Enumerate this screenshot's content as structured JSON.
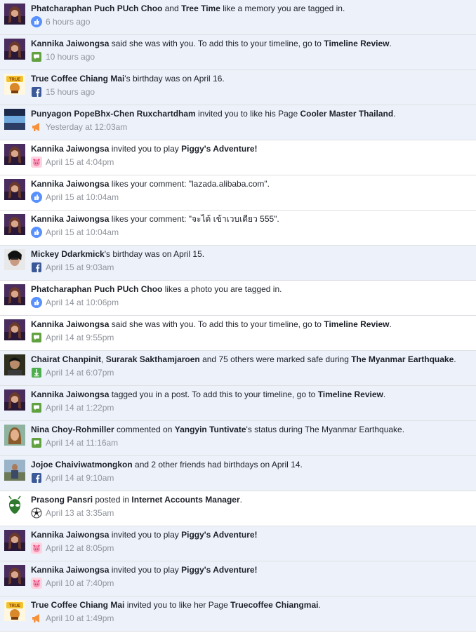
{
  "colors": {
    "unread_bg": "#edf2fa",
    "read_bg": "#ffffff",
    "link": "#1d2129",
    "meta": "#90949c",
    "divider": "#dddfe2"
  },
  "notifications": [
    {
      "avatar": "purple-portrait",
      "icon": "like-icon",
      "read": false,
      "parts": [
        {
          "t": "Phatcharaphan Puch PUch Choo",
          "b": true
        },
        {
          "t": " and "
        },
        {
          "t": "Tree Time",
          "b": true
        },
        {
          "t": " like a memory you are tagged in."
        }
      ],
      "time": "6 hours ago"
    },
    {
      "avatar": "purple-portrait",
      "icon": "comment-icon",
      "read": false,
      "parts": [
        {
          "t": "Kannika Jaiwongsa",
          "b": true
        },
        {
          "t": " said she was with you. To add this to your timeline, go to "
        },
        {
          "t": "Timeline Review",
          "b": true
        },
        {
          "t": "."
        }
      ],
      "time": "10 hours ago"
    },
    {
      "avatar": "coffee-logo",
      "icon": "facebook-icon",
      "read": false,
      "parts": [
        {
          "t": "True Coffee Chiang Mai",
          "b": true
        },
        {
          "t": "'s birthday was on April 16."
        }
      ],
      "time": "15 hours ago"
    },
    {
      "avatar": "blue-page",
      "icon": "megaphone-icon",
      "read": false,
      "parts": [
        {
          "t": "Punyagon PopeBhx-Chen Ruxchartdham",
          "b": true
        },
        {
          "t": " invited you to like his Page "
        },
        {
          "t": "Cooler Master Thailand",
          "b": true
        },
        {
          "t": "."
        }
      ],
      "time": "Yesterday at 12:03am"
    },
    {
      "avatar": "purple-portrait",
      "icon": "game-icon",
      "read": true,
      "parts": [
        {
          "t": "Kannika Jaiwongsa",
          "b": true
        },
        {
          "t": " invited you to play "
        },
        {
          "t": "Piggy's Adventure!",
          "b": true
        }
      ],
      "time": "April 15 at 4:04pm"
    },
    {
      "avatar": "purple-portrait",
      "icon": "like-icon",
      "read": true,
      "parts": [
        {
          "t": "Kannika Jaiwongsa",
          "b": true
        },
        {
          "t": " likes your comment: \"lazada.alibaba.com\"."
        }
      ],
      "time": "April 15 at 10:04am"
    },
    {
      "avatar": "purple-portrait",
      "icon": "like-icon",
      "read": true,
      "parts": [
        {
          "t": "Kannika Jaiwongsa",
          "b": true
        },
        {
          "t": " likes your comment: \"จะได้ เข้าเวบเดียว 555\"."
        }
      ],
      "time": "April 15 at 10:04am"
    },
    {
      "avatar": "dark-portrait",
      "icon": "facebook-icon",
      "read": false,
      "parts": [
        {
          "t": "Mickey Ddarkmick",
          "b": true
        },
        {
          "t": "'s birthday was on April 15."
        }
      ],
      "time": "April 15 at 9:03am"
    },
    {
      "avatar": "purple-portrait",
      "icon": "like-icon",
      "read": true,
      "parts": [
        {
          "t": "Phatcharaphan Puch PUch Choo",
          "b": true
        },
        {
          "t": " likes a photo you are tagged in."
        }
      ],
      "time": "April 14 at 10:06pm"
    },
    {
      "avatar": "purple-portrait",
      "icon": "comment-icon",
      "read": true,
      "parts": [
        {
          "t": "Kannika Jaiwongsa",
          "b": true
        },
        {
          "t": " said she was with you. To add this to your timeline, go to "
        },
        {
          "t": "Timeline Review",
          "b": true
        },
        {
          "t": "."
        }
      ],
      "time": "April 14 at 9:55pm"
    },
    {
      "avatar": "man-portrait",
      "icon": "safety-icon",
      "read": false,
      "parts": [
        {
          "t": "Chairat Chanpinit",
          "b": true
        },
        {
          "t": ", "
        },
        {
          "t": "Surarak Sakthamjaroen",
          "b": true
        },
        {
          "t": " and 75 others were marked safe during "
        },
        {
          "t": "The Myanmar Earthquake",
          "b": true
        },
        {
          "t": "."
        }
      ],
      "time": "April 14 at 6:07pm"
    },
    {
      "avatar": "purple-portrait",
      "icon": "comment-icon",
      "read": false,
      "parts": [
        {
          "t": "Kannika Jaiwongsa",
          "b": true
        },
        {
          "t": " tagged you in a post. To add this to your timeline, go to "
        },
        {
          "t": "Timeline Review",
          "b": true
        },
        {
          "t": "."
        }
      ],
      "time": "April 14 at 1:22pm"
    },
    {
      "avatar": "woman-portrait",
      "icon": "comment-icon",
      "read": false,
      "parts": [
        {
          "t": "Nina Choy-Rohmiller",
          "b": true
        },
        {
          "t": " commented on "
        },
        {
          "t": "Yangyin Tuntivate",
          "b": true
        },
        {
          "t": "'s status during The Myanmar Earthquake."
        }
      ],
      "time": "April 14 at 11:16am"
    },
    {
      "avatar": "outdoor-portrait",
      "icon": "facebook-icon",
      "read": false,
      "parts": [
        {
          "t": "Jojoe Chaiviwatmongkon",
          "b": true
        },
        {
          "t": " and 2 other friends had birthdays on April 14."
        }
      ],
      "time": "April 14 at 9:10am"
    },
    {
      "avatar": "alien-logo",
      "icon": "soccer-ball-icon",
      "read": true,
      "parts": [
        {
          "t": "Prasong Pansri",
          "b": true
        },
        {
          "t": " posted in "
        },
        {
          "t": "Internet Accounts Manager",
          "b": true
        },
        {
          "t": "."
        }
      ],
      "time": "April 13 at 3:35am"
    },
    {
      "avatar": "purple-portrait",
      "icon": "game-icon",
      "read": false,
      "parts": [
        {
          "t": "Kannika Jaiwongsa",
          "b": true
        },
        {
          "t": " invited you to play "
        },
        {
          "t": "Piggy's Adventure!",
          "b": true
        }
      ],
      "time": "April 12 at 8:05pm"
    },
    {
      "avatar": "purple-portrait",
      "icon": "game-icon",
      "read": false,
      "parts": [
        {
          "t": "Kannika Jaiwongsa",
          "b": true
        },
        {
          "t": " invited you to play "
        },
        {
          "t": "Piggy's Adventure!",
          "b": true
        }
      ],
      "time": "April 10 at 7:40pm"
    },
    {
      "avatar": "coffee-logo",
      "icon": "megaphone-icon",
      "read": false,
      "parts": [
        {
          "t": "True Coffee Chiang Mai",
          "b": true
        },
        {
          "t": " invited you to like her Page "
        },
        {
          "t": "Truecoffee Chiangmai",
          "b": true
        },
        {
          "t": "."
        }
      ],
      "time": "April 10 at 1:49pm"
    }
  ]
}
